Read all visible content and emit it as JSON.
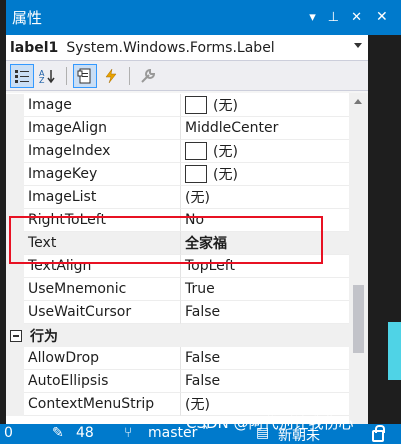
{
  "panel": {
    "title": "属性",
    "controls": {
      "dropdown": "▾",
      "pin": "⊥",
      "close": "✕"
    }
  },
  "object_selector": {
    "name": "label1",
    "type": "System.Windows.Forms.Label"
  },
  "toolbar": {
    "buttons": [
      "categorized-icon",
      "alphabetical-icon",
      "properties-icon",
      "events-icon",
      "property-pages-icon"
    ]
  },
  "rows": [
    {
      "name": "Image",
      "value": "(无)",
      "swatch": true
    },
    {
      "name": "ImageAlign",
      "value": "MiddleCenter"
    },
    {
      "name": "ImageIndex",
      "value": "(无)",
      "swatch": true
    },
    {
      "name": "ImageKey",
      "value": "(无)",
      "swatch": true
    },
    {
      "name": "ImageList",
      "value": "(无)"
    },
    {
      "name": "RightToLeft",
      "value": "No"
    },
    {
      "name": "Text",
      "value": "全家福",
      "bold": true,
      "selected": true
    },
    {
      "name": "TextAlign",
      "value": "TopLeft"
    },
    {
      "name": "UseMnemonic",
      "value": "True"
    },
    {
      "name": "UseWaitCursor",
      "value": "False"
    }
  ],
  "category": {
    "label": "行为"
  },
  "rows2": [
    {
      "name": "AllowDrop",
      "value": "False"
    },
    {
      "name": "AutoEllipsis",
      "value": "False"
    },
    {
      "name": "ContextMenuStrip",
      "value": "(无)"
    }
  ],
  "status": {
    "errors": "0",
    "pencil_count": "48",
    "branch": "master",
    "extra": "新朝未"
  },
  "watermark": "CSDN @阿代别让我伤心",
  "colors": {
    "accent": "#007acc",
    "highlight": "#e81123"
  }
}
